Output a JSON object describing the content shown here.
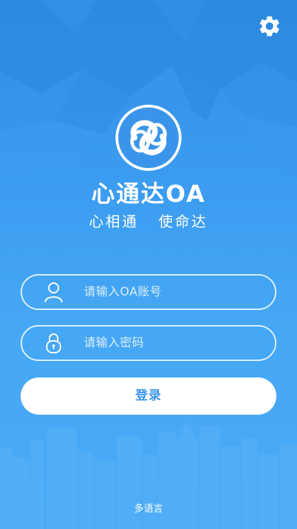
{
  "header": {
    "settings_icon": "gear-icon"
  },
  "brand": {
    "title": "心通达OA",
    "slogan": "心相通   使命达",
    "logo_icon": "interlocked-rings-logo"
  },
  "form": {
    "account": {
      "placeholder": "请输入OA账号",
      "value": "",
      "icon": "user-icon"
    },
    "password": {
      "placeholder": "请输入密码",
      "value": "",
      "icon": "lock-icon"
    },
    "login_label": "登录"
  },
  "footer": {
    "language_label": "多语言"
  },
  "colors": {
    "background_top": "#2f8fe6",
    "background_bottom": "#4aaaf6",
    "button_text": "#3a95ea",
    "white": "#ffffff"
  }
}
